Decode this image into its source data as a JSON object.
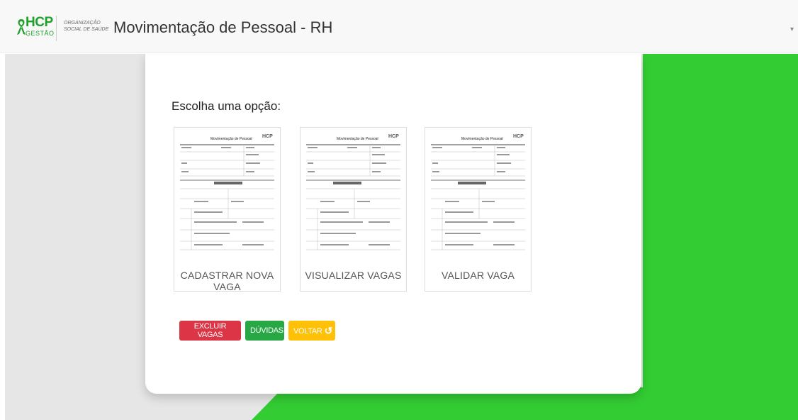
{
  "header": {
    "logo_main": "HCP",
    "logo_sub": "GESTÃO",
    "org_line1": "ORGANIZAÇÃO",
    "org_line2": "SOCIAL DE SAÚDE",
    "title": "Movimentação de Pessoal - RH"
  },
  "main": {
    "prompt": "Escolha uma opção:",
    "options": [
      {
        "label": "CADASTRAR NOVA VAGA",
        "form_title": "Movimentação de Pessoal"
      },
      {
        "label": "VISUALIZAR VAGAS",
        "form_title": "Movimentação de Pessoal"
      },
      {
        "label": "VALIDAR VAGA",
        "form_title": "Movimentação de Pessoal"
      }
    ],
    "buttons": {
      "delete": "EXCLUIR VAGAS",
      "help": "DÚVIDAS",
      "back": "VOLTAR"
    }
  },
  "colors": {
    "brand_green": "#1fa02a",
    "background_green": "#33cc33",
    "danger": "#dc3545",
    "success": "#28a745",
    "warning": "#ffc107"
  },
  "icons": [
    "ribbon-logo-icon",
    "undo-icon",
    "caret-down-icon"
  ]
}
